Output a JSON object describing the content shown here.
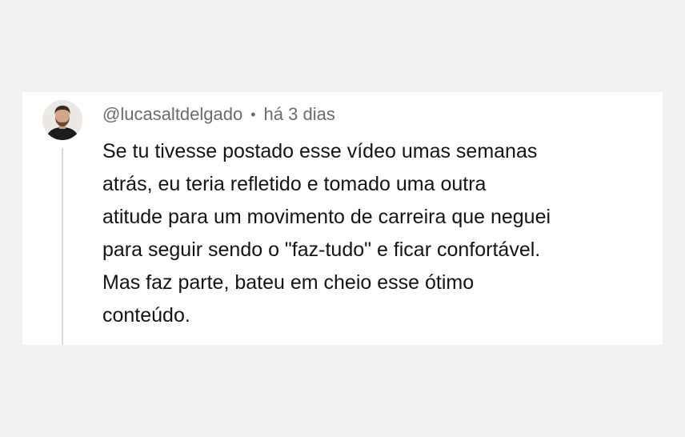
{
  "comment": {
    "username": "@lucasaltdelgado",
    "separator": "•",
    "timestamp": "há 3 dias",
    "text": "Se tu tivesse postado esse vídeo umas semanas\natrás, eu teria refletido e tomado uma outra\natitude para um movimento de carreira que neguei\npara seguir sendo o \"faz-tudo\" e ficar confortável.\nMas faz parte, bateu em cheio esse ótimo\nconteúdo."
  },
  "colors": {
    "page_background": "#f2f2f4",
    "card_background": "#ffffff",
    "meta_text": "#6b6b6b",
    "body_text": "#141414",
    "thread_line": "#d9d9d9"
  }
}
